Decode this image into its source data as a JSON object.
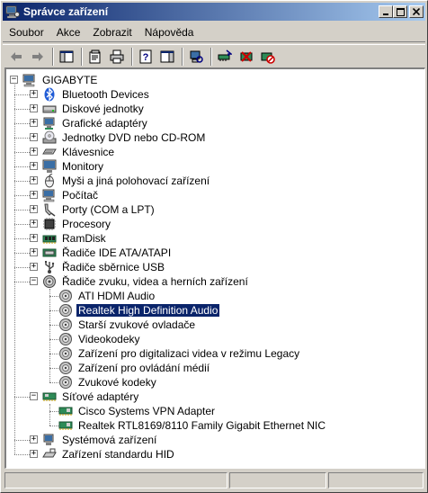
{
  "window": {
    "title": "Správce zařízení"
  },
  "menu": [
    {
      "label": "Soubor"
    },
    {
      "label": "Akce"
    },
    {
      "label": "Zobrazit"
    },
    {
      "label": "Nápověda"
    }
  ],
  "toolbar": [
    {
      "icon": "back-arrow-icon"
    },
    {
      "icon": "forward-arrow-icon"
    },
    {
      "icon": "show-hide-console-tree-icon"
    },
    {
      "icon": "properties-icon"
    },
    {
      "icon": "print-icon"
    },
    {
      "icon": "help-icon"
    },
    {
      "icon": "show-hide-action-pane-icon"
    },
    {
      "icon": "scan-hardware-icon"
    },
    {
      "icon": "update-driver-icon"
    },
    {
      "icon": "uninstall-icon"
    },
    {
      "icon": "disable-icon"
    }
  ],
  "tree": {
    "root": "GIGABYTE",
    "categories": [
      {
        "label": "Bluetooth Devices",
        "icon": "bluetooth-icon",
        "expanded": false
      },
      {
        "label": "Diskové jednotky",
        "icon": "disk-drive-icon",
        "expanded": false
      },
      {
        "label": "Grafické adaptéry",
        "icon": "display-adapter-icon",
        "expanded": false
      },
      {
        "label": "Jednotky DVD nebo CD-ROM",
        "icon": "cdrom-icon",
        "expanded": false
      },
      {
        "label": "Klávesnice",
        "icon": "keyboard-icon",
        "expanded": false
      },
      {
        "label": "Monitory",
        "icon": "monitor-icon",
        "expanded": false
      },
      {
        "label": "Myši a jiná polohovací zařízení",
        "icon": "mouse-icon",
        "expanded": false
      },
      {
        "label": "Počítač",
        "icon": "computer-icon",
        "expanded": false
      },
      {
        "label": "Porty (COM a LPT)",
        "icon": "port-icon",
        "expanded": false
      },
      {
        "label": "Procesory",
        "icon": "processor-icon",
        "expanded": false
      },
      {
        "label": "RamDisk",
        "icon": "ramdisk-icon",
        "expanded": false
      },
      {
        "label": "Řadiče IDE ATA/ATAPI",
        "icon": "ide-controller-icon",
        "expanded": false
      },
      {
        "label": "Řadiče sběrnice USB",
        "icon": "usb-icon",
        "expanded": false
      },
      {
        "label": "Řadiče zvuku, videa a herních zařízení",
        "icon": "sound-icon",
        "expanded": true,
        "children": [
          {
            "label": "ATI HDMI Audio",
            "selected": false
          },
          {
            "label": "Realtek High Definition Audio",
            "selected": true
          },
          {
            "label": "Starší zvukové ovladače",
            "selected": false
          },
          {
            "label": "Videokodeky",
            "selected": false
          },
          {
            "label": "Zařízení pro digitalizaci videa v režimu Legacy",
            "selected": false
          },
          {
            "label": "Zařízení pro ovládání médií",
            "selected": false
          },
          {
            "label": "Zvukové kodeky",
            "selected": false
          }
        ]
      },
      {
        "label": "Síťové adaptéry",
        "icon": "network-adapter-icon",
        "expanded": true,
        "children": [
          {
            "label": "Cisco Systems VPN Adapter",
            "selected": false
          },
          {
            "label": "Realtek RTL8169/8110 Family Gigabit Ethernet NIC",
            "selected": false
          }
        ]
      },
      {
        "label": "Systémová zařízení",
        "icon": "system-device-icon",
        "expanded": false
      },
      {
        "label": "Zařízení standardu HID",
        "icon": "hid-icon",
        "expanded": false
      }
    ]
  },
  "colors": {
    "titlebar_start": "#0a246a",
    "titlebar_end": "#a6caf0",
    "selection": "#0a246a",
    "chrome": "#d4d0c8"
  }
}
